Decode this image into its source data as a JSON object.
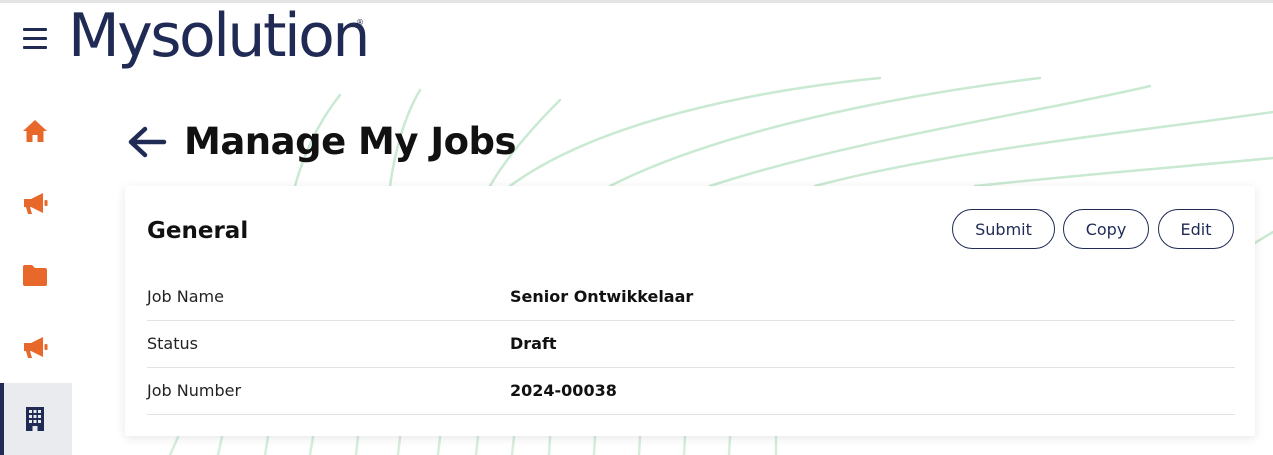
{
  "app": {
    "logo_text": "Mysolution",
    "logo_mark": "®"
  },
  "header": {
    "menu_icon": "hamburger-icon"
  },
  "sidebar": {
    "items": [
      {
        "icon": "home-icon",
        "active": false
      },
      {
        "icon": "megaphone-icon",
        "active": false
      },
      {
        "icon": "folder-icon",
        "active": false
      },
      {
        "icon": "megaphone-icon",
        "active": false
      },
      {
        "icon": "building-icon",
        "active": true
      }
    ]
  },
  "page": {
    "title": "Manage My Jobs",
    "back_icon": "arrow-left-icon"
  },
  "card": {
    "title": "General",
    "buttons": {
      "submit": "Submit",
      "copy": "Copy",
      "edit": "Edit"
    },
    "rows": [
      {
        "label": "Job Name",
        "value": "Senior Ontwikkelaar"
      },
      {
        "label": "Status",
        "value": "Draft"
      },
      {
        "label": "Job Number",
        "value": "2024-00038"
      }
    ]
  },
  "colors": {
    "brand_navy": "#1f2a55",
    "icon_orange": "#e8672a",
    "decor_green": "#bfe3c8",
    "active_nav_bg": "#e9ebef"
  }
}
